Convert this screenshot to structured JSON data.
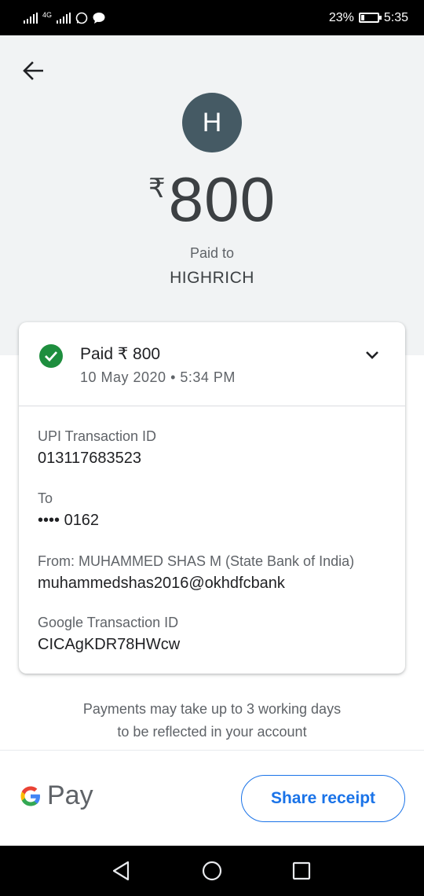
{
  "status_bar": {
    "network": "4G",
    "battery": "23%",
    "battery_level": 0.23,
    "time": "5:35"
  },
  "header": {
    "avatar_letter": "H",
    "currency": "₹",
    "amount": "800",
    "paid_to_label": "Paid to",
    "payee": "HIGHRICH"
  },
  "card": {
    "status": "Paid ₹ 800",
    "datetime": "10 May 2020 • 5:34 PM",
    "upi_label": "UPI Transaction ID",
    "upi_id": "013117683523",
    "to_label": "To",
    "to_value": "•••• 0162",
    "from_label": "From: MUHAMMED SHAS  M (State Bank of India)",
    "from_value": "muhammedshas2016@okhdfcbank",
    "google_label": "Google Transaction ID",
    "google_id": "CICAgKDR78HWcw"
  },
  "note": {
    "line1": "Payments may take up to 3 working days",
    "line2": "to be reflected in your account"
  },
  "footer": {
    "brand_g": "G",
    "brand_pay": "Pay",
    "share_label": "Share receipt"
  },
  "colors": {
    "header_bg": "#f1f3f4",
    "avatar_bg": "#455a64",
    "success_green": "#1e8e3e",
    "accent_blue": "#1a73e8"
  },
  "icons": [
    "signal-icon",
    "whatsapp-icon",
    "message-icon",
    "back-arrow-icon",
    "check-circle-icon",
    "chevron-down-icon",
    "google-g-icon",
    "nav-back-icon",
    "nav-home-icon",
    "nav-recents-icon"
  ]
}
